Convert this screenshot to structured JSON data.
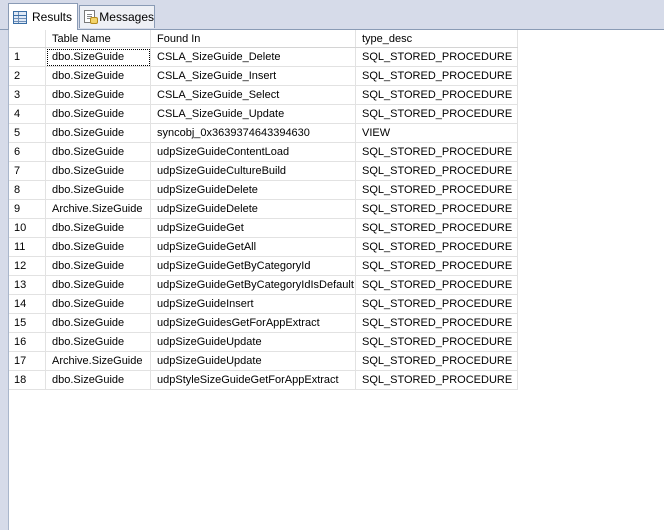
{
  "tabs": {
    "results_label": "Results",
    "messages_label": "Messages"
  },
  "grid": {
    "columns": [
      "",
      "Table Name",
      "Found In",
      "type_desc"
    ],
    "rows": [
      {
        "n": "1",
        "table": "dbo.SizeGuide",
        "found_in": "CSLA_SizeGuide_Delete",
        "type_desc": "SQL_STORED_PROCEDURE"
      },
      {
        "n": "2",
        "table": "dbo.SizeGuide",
        "found_in": "CSLA_SizeGuide_Insert",
        "type_desc": "SQL_STORED_PROCEDURE"
      },
      {
        "n": "3",
        "table": "dbo.SizeGuide",
        "found_in": "CSLA_SizeGuide_Select",
        "type_desc": "SQL_STORED_PROCEDURE"
      },
      {
        "n": "4",
        "table": "dbo.SizeGuide",
        "found_in": "CSLA_SizeGuide_Update",
        "type_desc": "SQL_STORED_PROCEDURE"
      },
      {
        "n": "5",
        "table": "dbo.SizeGuide",
        "found_in": "syncobj_0x3639374643394630",
        "type_desc": "VIEW"
      },
      {
        "n": "6",
        "table": "dbo.SizeGuide",
        "found_in": "udpSizeGuideContentLoad",
        "type_desc": "SQL_STORED_PROCEDURE"
      },
      {
        "n": "7",
        "table": "dbo.SizeGuide",
        "found_in": "udpSizeGuideCultureBuild",
        "type_desc": "SQL_STORED_PROCEDURE"
      },
      {
        "n": "8",
        "table": "dbo.SizeGuide",
        "found_in": "udpSizeGuideDelete",
        "type_desc": "SQL_STORED_PROCEDURE"
      },
      {
        "n": "9",
        "table": "Archive.SizeGuide",
        "found_in": "udpSizeGuideDelete",
        "type_desc": "SQL_STORED_PROCEDURE"
      },
      {
        "n": "10",
        "table": "dbo.SizeGuide",
        "found_in": "udpSizeGuideGet",
        "type_desc": "SQL_STORED_PROCEDURE"
      },
      {
        "n": "11",
        "table": "dbo.SizeGuide",
        "found_in": "udpSizeGuideGetAll",
        "type_desc": "SQL_STORED_PROCEDURE"
      },
      {
        "n": "12",
        "table": "dbo.SizeGuide",
        "found_in": "udpSizeGuideGetByCategoryId",
        "type_desc": "SQL_STORED_PROCEDURE"
      },
      {
        "n": "13",
        "table": "dbo.SizeGuide",
        "found_in": "udpSizeGuideGetByCategoryIdIsDefault",
        "type_desc": "SQL_STORED_PROCEDURE"
      },
      {
        "n": "14",
        "table": "dbo.SizeGuide",
        "found_in": "udpSizeGuideInsert",
        "type_desc": "SQL_STORED_PROCEDURE"
      },
      {
        "n": "15",
        "table": "dbo.SizeGuide",
        "found_in": "udpSizeGuidesGetForAppExtract",
        "type_desc": "SQL_STORED_PROCEDURE"
      },
      {
        "n": "16",
        "table": "dbo.SizeGuide",
        "found_in": "udpSizeGuideUpdate",
        "type_desc": "SQL_STORED_PROCEDURE"
      },
      {
        "n": "17",
        "table": "Archive.SizeGuide",
        "found_in": "udpSizeGuideUpdate",
        "type_desc": "SQL_STORED_PROCEDURE"
      },
      {
        "n": "18",
        "table": "dbo.SizeGuide",
        "found_in": "udpStyleSizeGuideGetForAppExtract",
        "type_desc": "SQL_STORED_PROCEDURE"
      }
    ]
  }
}
